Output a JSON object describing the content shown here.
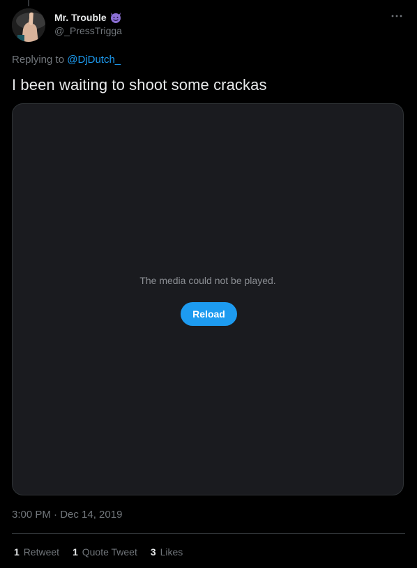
{
  "author": {
    "display_name": "Mr. Trouble",
    "handle": "@_PressTrigga",
    "emoji_icon": "smiling-devil-icon"
  },
  "reply": {
    "prefix": "Replying to",
    "mention": "@DjDutch_"
  },
  "tweet": {
    "text": "I been waiting to shoot some crackas"
  },
  "media": {
    "error_message": "The media could not be played.",
    "reload_label": "Reload"
  },
  "timestamp": "3:00 PM · Dec 14, 2019",
  "stats": {
    "retweets": {
      "count": "1",
      "label": "Retweet"
    },
    "quote_tweets": {
      "count": "1",
      "label": "Quote Tweet"
    },
    "likes": {
      "count": "3",
      "label": "Likes"
    }
  },
  "colors": {
    "background": "#000000",
    "accent": "#1d9bf0",
    "muted_text": "#71767b",
    "media_bg": "#1a1b1f",
    "devil": "#8b6fd4"
  }
}
